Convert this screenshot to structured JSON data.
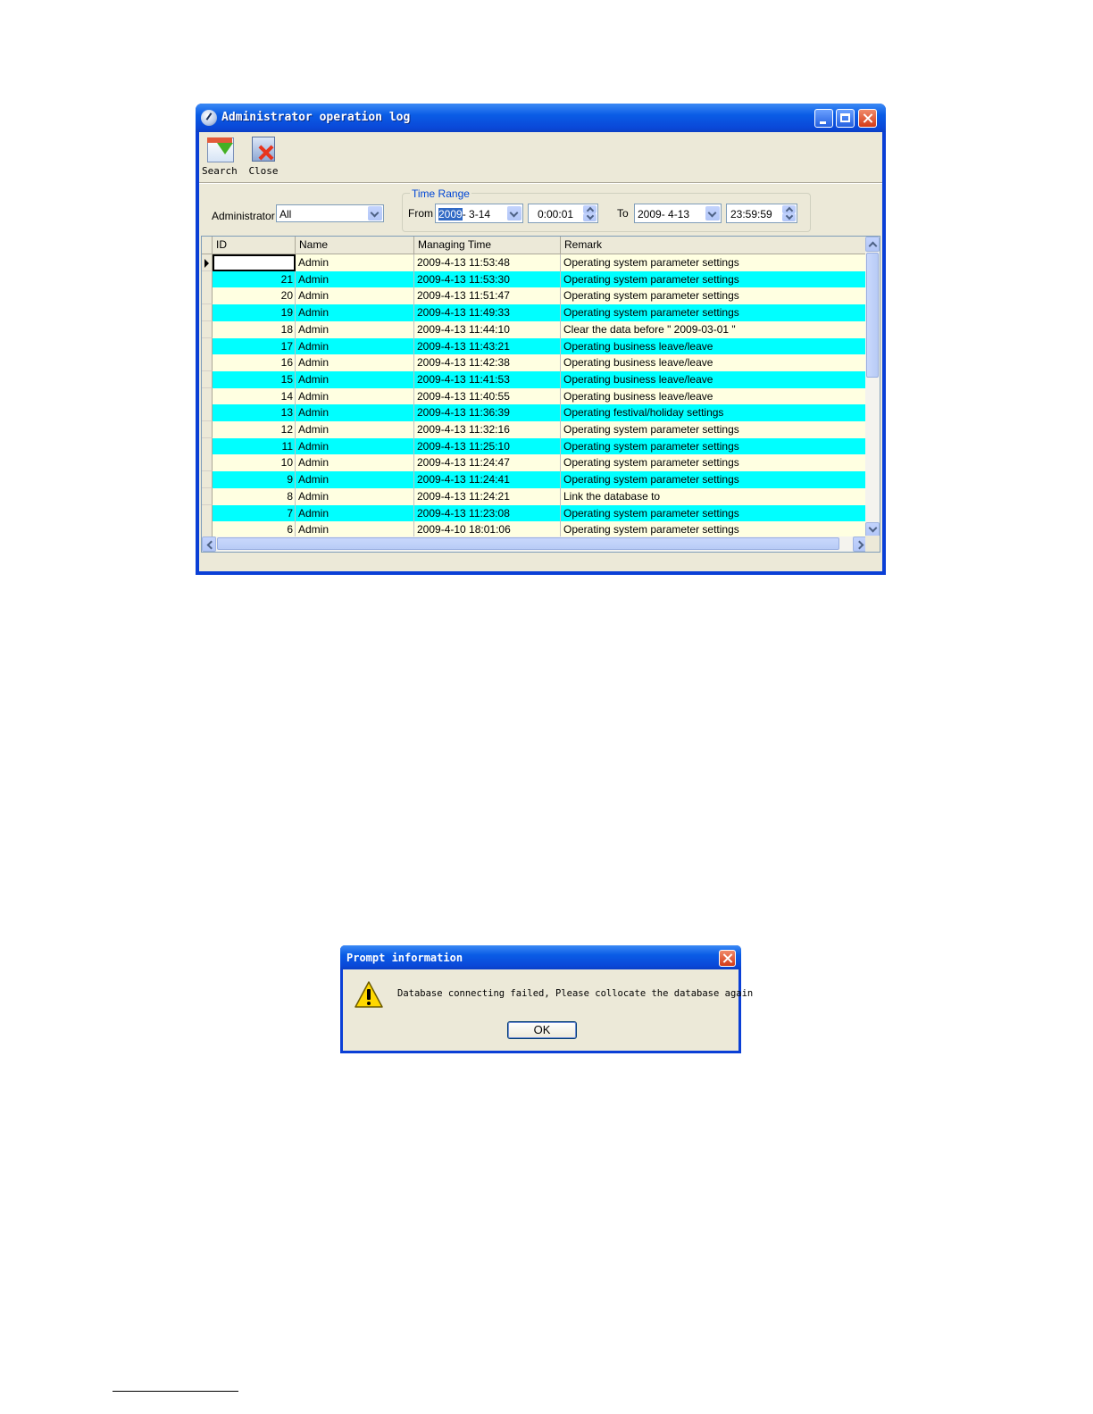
{
  "window": {
    "title": "Administrator operation log",
    "toolbar": {
      "search_label": "Search",
      "close_label": "Close"
    },
    "filter": {
      "admin_label": "Administrator",
      "admin_value": "All",
      "time_range_title": "Time Range",
      "from_label": "From",
      "from_date_year": "2009",
      "from_date_rest": "-  3-14",
      "from_time": "0:00:01",
      "to_label": "To",
      "to_date": "2009-  4-13",
      "to_time": "23:59:59"
    },
    "grid": {
      "columns": [
        "ID",
        "Name",
        "Managing Time",
        "Remark"
      ],
      "rows": [
        {
          "id": "",
          "name": "Admin",
          "time": "2009-4-13 11:53:48",
          "remark": "Operating system parameter settings"
        },
        {
          "id": "21",
          "name": "Admin",
          "time": "2009-4-13 11:53:30",
          "remark": "Operating system parameter settings"
        },
        {
          "id": "20",
          "name": "Admin",
          "time": "2009-4-13 11:51:47",
          "remark": "Operating system parameter settings"
        },
        {
          "id": "19",
          "name": "Admin",
          "time": "2009-4-13 11:49:33",
          "remark": "Operating system parameter settings"
        },
        {
          "id": "18",
          "name": "Admin",
          "time": "2009-4-13 11:44:10",
          "remark": "Clear the data before \" 2009-03-01 \""
        },
        {
          "id": "17",
          "name": "Admin",
          "time": "2009-4-13 11:43:21",
          "remark": "Operating business leave/leave"
        },
        {
          "id": "16",
          "name": "Admin",
          "time": "2009-4-13 11:42:38",
          "remark": "Operating business leave/leave"
        },
        {
          "id": "15",
          "name": "Admin",
          "time": "2009-4-13 11:41:53",
          "remark": "Operating business leave/leave"
        },
        {
          "id": "14",
          "name": "Admin",
          "time": "2009-4-13 11:40:55",
          "remark": "Operating business leave/leave"
        },
        {
          "id": "13",
          "name": "Admin",
          "time": "2009-4-13 11:36:39",
          "remark": "Operating festival/holiday settings"
        },
        {
          "id": "12",
          "name": "Admin",
          "time": "2009-4-13 11:32:16",
          "remark": "Operating system parameter settings"
        },
        {
          "id": "11",
          "name": "Admin",
          "time": "2009-4-13 11:25:10",
          "remark": "Operating system parameter settings"
        },
        {
          "id": "10",
          "name": "Admin",
          "time": "2009-4-13 11:24:47",
          "remark": "Operating system parameter settings"
        },
        {
          "id": "9",
          "name": "Admin",
          "time": "2009-4-13 11:24:41",
          "remark": "Operating system parameter settings"
        },
        {
          "id": "8",
          "name": "Admin",
          "time": "2009-4-13 11:24:21",
          "remark": "Link the database to"
        },
        {
          "id": "7",
          "name": "Admin",
          "time": "2009-4-13 11:23:08",
          "remark": "Operating system parameter settings"
        },
        {
          "id": "6",
          "name": "Admin",
          "time": "2009-4-10 18:01:06",
          "remark": "Operating system parameter settings"
        }
      ]
    }
  },
  "dialog": {
    "title": "Prompt information",
    "message": "Database connecting failed, Please collocate the database again",
    "ok_label": "OK"
  },
  "colors": {
    "row_odd": "#ffffe1",
    "row_even": "#00ffff",
    "titlebar": "#0a5ce6",
    "group_title": "#0046d5"
  }
}
